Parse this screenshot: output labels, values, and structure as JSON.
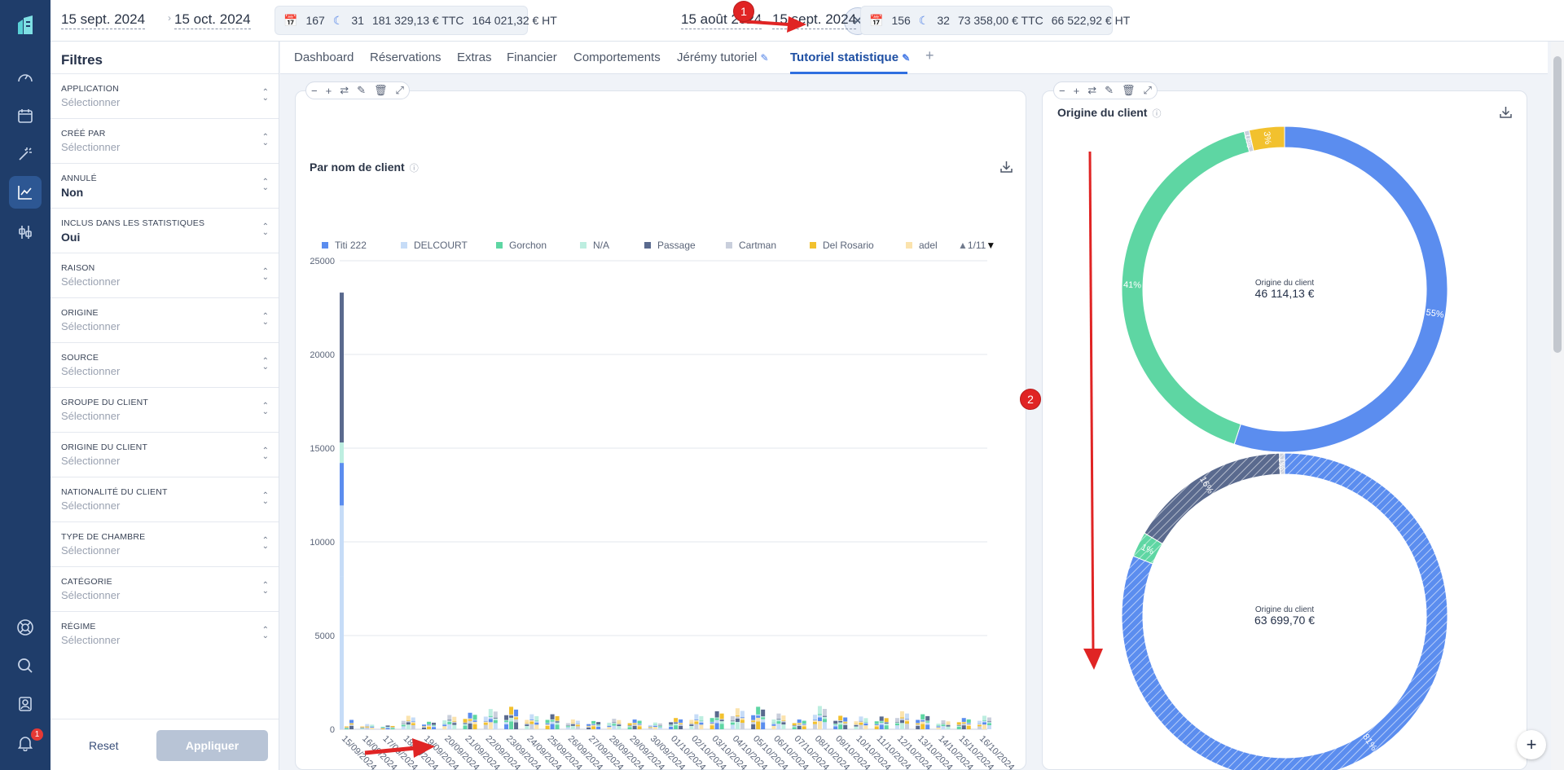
{
  "header": {
    "period1": {
      "start": "15 sept. 2024",
      "end": "15 oct. 2024",
      "bookings": "167",
      "nights": "31",
      "ttc": "181 329,13 € TTC",
      "ht": "164 021,32 € HT"
    },
    "period2": {
      "start": "15 août 2024",
      "end": "15 sept. 2024",
      "bookings": "156",
      "nights": "32",
      "ttc": "73 358,00 € TTC",
      "ht": "66 522,92 € HT"
    }
  },
  "filters": {
    "title": "Filtres",
    "items": [
      {
        "label": "APPLICATION",
        "value": "Sélectionner",
        "set": false
      },
      {
        "label": "CRÉÉ PAR",
        "value": "Sélectionner",
        "set": false
      },
      {
        "label": "ANNULÉ",
        "value": "Non",
        "set": true
      },
      {
        "label": "INCLUS DANS LES STATISTIQUES",
        "value": "Oui",
        "set": true
      },
      {
        "label": "RAISON",
        "value": "Sélectionner",
        "set": false
      },
      {
        "label": "ORIGINE",
        "value": "Sélectionner",
        "set": false
      },
      {
        "label": "SOURCE",
        "value": "Sélectionner",
        "set": false
      },
      {
        "label": "GROUPE DU CLIENT",
        "value": "Sélectionner",
        "set": false
      },
      {
        "label": "ORIGINE DU CLIENT",
        "value": "Sélectionner",
        "set": false
      },
      {
        "label": "NATIONALITÉ DU CLIENT",
        "value": "Sélectionner",
        "set": false
      },
      {
        "label": "TYPE DE CHAMBRE",
        "value": "Sélectionner",
        "set": false
      },
      {
        "label": "CATÉGORIE",
        "value": "Sélectionner",
        "set": false
      },
      {
        "label": "RÉGIME",
        "value": "Sélectionner",
        "set": false
      }
    ],
    "reset_label": "Reset",
    "apply_label": "Appliquer"
  },
  "tabs": [
    "Dashboard",
    "Réservations",
    "Extras",
    "Financier",
    "Comportements",
    "Jérémy tutoriel",
    "Tutoriel statistique"
  ],
  "active_tab": "Tutoriel statistique",
  "annotations": [
    "1",
    "2"
  ],
  "notification_count": "1",
  "colors": {
    "accent": "#2f6fe0",
    "sidebar": "#1f3d6a",
    "annotation": "#e02424"
  },
  "bar_chart": {
    "title": "Par nom de client",
    "legend_page": "1/11",
    "legend": [
      {
        "name": "Titi 222",
        "color": "#5b8def"
      },
      {
        "name": "DELCOURT",
        "color": "#c6dcf7"
      },
      {
        "name": "Gorchon",
        "color": "#5ed6a3"
      },
      {
        "name": "N/A",
        "color": "#bdeee0"
      },
      {
        "name": "Passage",
        "color": "#5a6a8e"
      },
      {
        "name": "Cartman",
        "color": "#c9cfdc"
      },
      {
        "name": "Del Rosario",
        "color": "#f2c12e"
      },
      {
        "name": "adel",
        "color": "#fbe3ad"
      }
    ],
    "y_ticks": [
      "25000",
      "20000",
      "15000",
      "10000",
      "5000",
      "0"
    ]
  },
  "donut_chart": {
    "title": "Origine du client",
    "center_label": "Origine du client",
    "current_total": "46 114,13 €",
    "previous_total": "63 699,70 €",
    "current_labels": [
      "55%",
      "41%",
      "0%",
      "3%"
    ],
    "previous_labels": [
      "81%",
      "1%",
      "16%",
      "1%"
    ]
  },
  "chart_data": [
    {
      "type": "bar",
      "title": "Par nom de client",
      "categories": [
        "15/09/2024",
        "16/09/2024",
        "17/09/2024",
        "18/09/2024",
        "19/09/2024",
        "20/09/2024",
        "21/09/2024",
        "22/09/2024",
        "23/09/2024",
        "24/09/2024",
        "25/09/2024",
        "26/09/2024",
        "27/09/2024",
        "28/09/2024",
        "29/09/2024",
        "30/09/2024",
        "01/10/2024",
        "02/10/2024",
        "03/10/2024",
        "04/10/2024",
        "05/10/2024",
        "06/10/2024",
        "07/10/2024",
        "08/10/2024",
        "09/10/2024",
        "10/10/2024",
        "11/10/2024",
        "12/10/2024",
        "13/10/2024",
        "14/10/2024",
        "15/10/2024",
        "16/10/2024"
      ],
      "ylim": [
        0,
        25000
      ],
      "values": [
        23300,
        700,
        500,
        1800,
        1000,
        1900,
        2200,
        2700,
        3000,
        2000,
        2000,
        1300,
        1100,
        1400,
        1300,
        900,
        1500,
        2000,
        2400,
        2800,
        3000,
        2100,
        1300,
        3100,
        1800,
        1700,
        1700,
        2400,
        2000,
        1200,
        1500,
        1800
      ]
    },
    {
      "type": "pie",
      "title": "Origine du client",
      "slices": [
        {
          "label": "55%",
          "value": 55,
          "color": "#5b8def"
        },
        {
          "label": "41%",
          "value": 41,
          "color": "#5ed6a3"
        },
        {
          "label": "0%",
          "value": 0.5,
          "color": "#c9cfdc"
        },
        {
          "label": "3%",
          "value": 3.5,
          "color": "#f2c12e"
        }
      ]
    },
    {
      "type": "pie",
      "title": "Origine du client",
      "slices": [
        {
          "label": "81%",
          "value": 81,
          "color": "#5b8def"
        },
        {
          "label": "1%",
          "value": 2.5,
          "color": "#5ed6a3"
        },
        {
          "label": "16%",
          "value": 16,
          "color": "#5a6a8e"
        },
        {
          "label": "1%",
          "value": 0.5,
          "color": "#c9cfdc"
        }
      ]
    }
  ]
}
